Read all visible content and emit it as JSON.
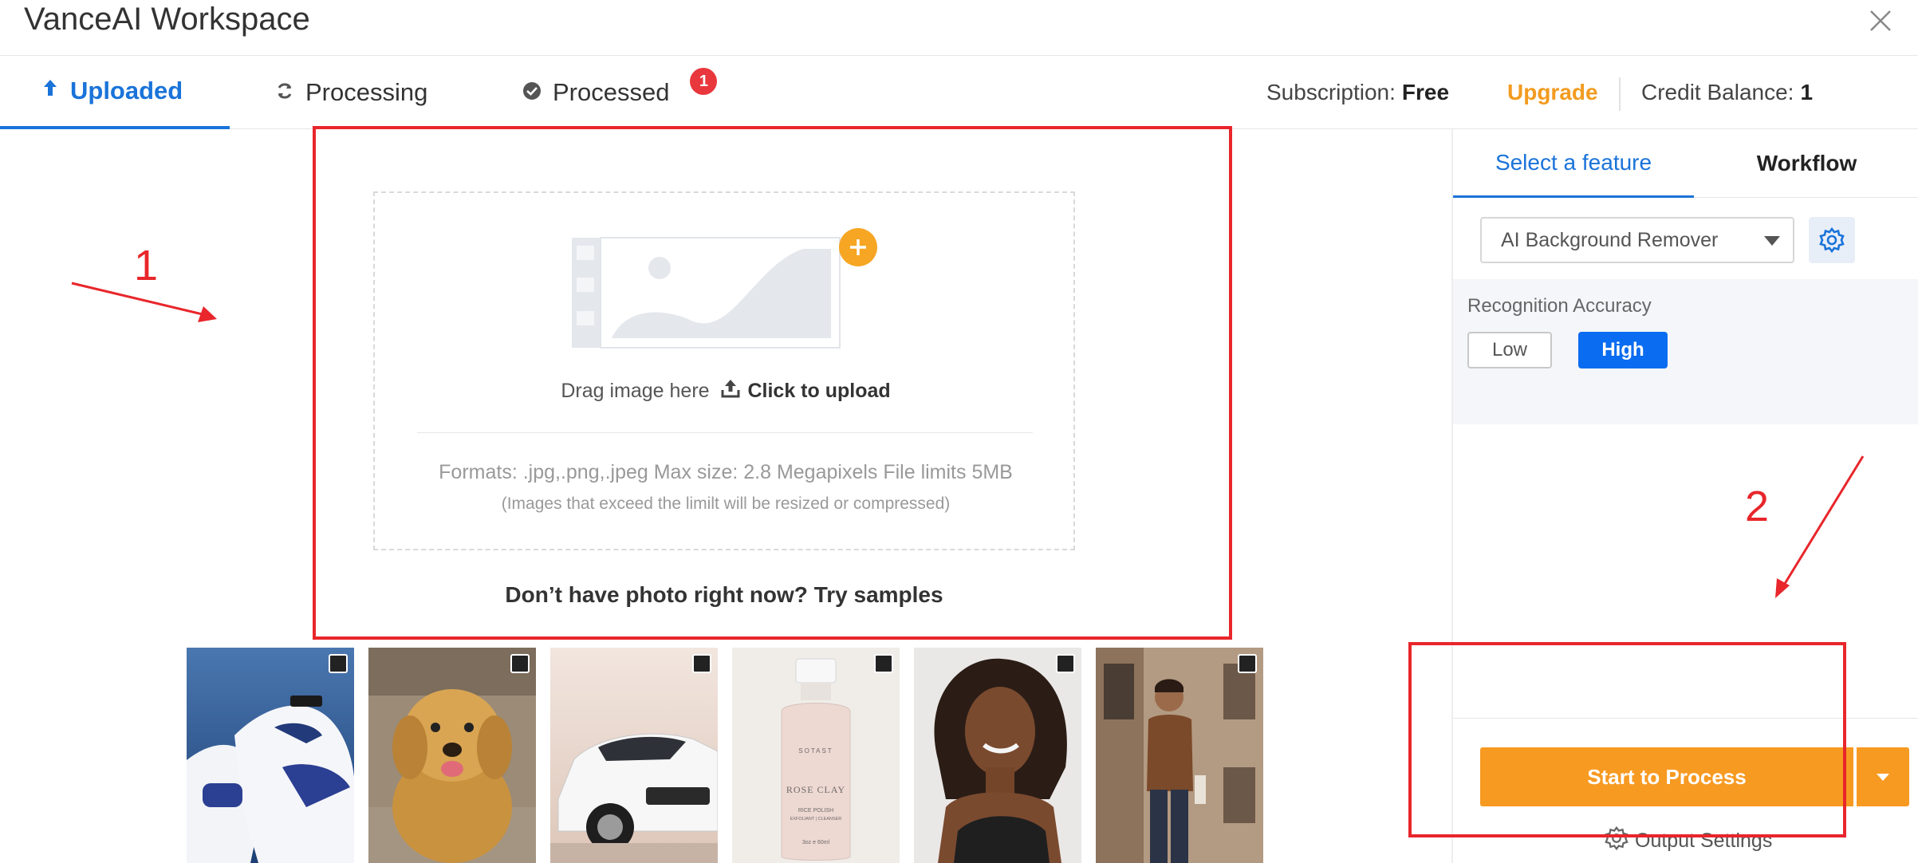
{
  "window": {
    "title": "VanceAI Workspace"
  },
  "tabs": [
    {
      "label": "Uploaded",
      "icon": "upload-arrow-icon"
    },
    {
      "label": "Processing",
      "icon": "refresh-icon"
    },
    {
      "label": "Processed",
      "icon": "check-circle-icon",
      "badge": "1"
    }
  ],
  "account": {
    "subscription_label": "Subscription:",
    "subscription_value": "Free",
    "upgrade_label": "Upgrade",
    "credit_label": "Credit Balance:",
    "credit_value": "1"
  },
  "right_panel": {
    "tabs": [
      "Select a feature",
      "Workflow"
    ],
    "feature_select_value": "AI Background Remover",
    "accuracy_label": "Recognition Accuracy",
    "accuracy_options": [
      "Low",
      "High"
    ],
    "accuracy_selected": "High",
    "start_button": "Start to Process",
    "output_settings": "Output Settings"
  },
  "upload": {
    "drag_text": "Drag image here",
    "click_text": "Click to upload",
    "formats": "Formats: .jpg,.png,.jpeg Max size: 2.8 Megapixels File limits 5MB",
    "note": "(Images that exceed the limilt will be resized or compressed)"
  },
  "samples_prompt": "Don’t have photo right now? Try samples",
  "samples": [
    {
      "name": "sneakers"
    },
    {
      "name": "puppy"
    },
    {
      "name": "car"
    },
    {
      "name": "cleanser-bottle",
      "label_lines": [
        "SOTAST",
        "ROSE CLAY",
        "RICE POLISH",
        "EXFOLIANT | CLEANSER",
        "3oz e 60ml"
      ]
    },
    {
      "name": "woman-portrait"
    },
    {
      "name": "man-street"
    }
  ],
  "annotations": [
    "1",
    "2"
  ],
  "colors": {
    "accent_blue": "#1a73d9",
    "primary_orange": "#f79a22",
    "upgrade_orange": "#f29b20",
    "badge_red": "#e8383d",
    "annotation_red": "#e8262b"
  }
}
